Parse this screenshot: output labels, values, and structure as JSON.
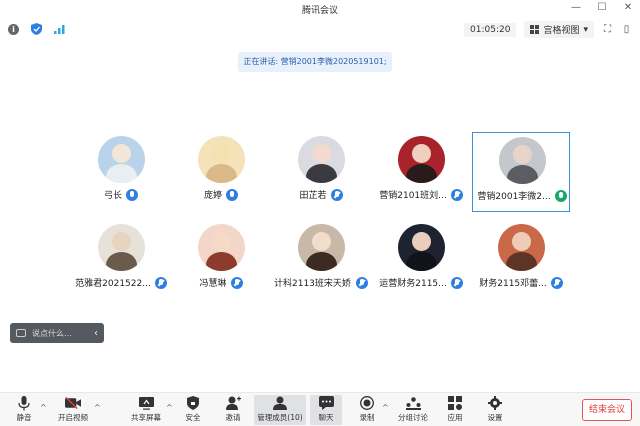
{
  "window": {
    "title": "腾讯会议"
  },
  "top": {
    "timer": "01:05:20",
    "view_label": "宫格视图"
  },
  "speaking": {
    "text": "正在讲话: 营销2001李微2020519101;"
  },
  "participants": [
    {
      "name": "弓长",
      "mic": "on",
      "colors": {
        "bg": "#b9d4ea",
        "head": "#f3e6d8",
        "body": "#e9eef3"
      }
    },
    {
      "name": "庞婷",
      "mic": "on",
      "colors": {
        "bg": "#f4e2b8",
        "head": "#f5e0b0",
        "body": "#d9b987"
      }
    },
    {
      "name": "田芷若",
      "mic": "muted",
      "colors": {
        "bg": "#d9dbe0",
        "head": "#f3d9cf",
        "body": "#3a3a40"
      }
    },
    {
      "name": "营销2101班刘...",
      "mic": "muted",
      "colors": {
        "bg": "#a8232c",
        "head": "#f0cfc0",
        "body": "#2a1b1b"
      }
    },
    {
      "name": "营销2001李微2...",
      "mic": "speaking",
      "active": true,
      "colors": {
        "bg": "#c4c7cc",
        "head": "#e7d4c9",
        "body": "#5b5d62"
      }
    },
    {
      "name": "范雅君2021522...",
      "mic": "muted",
      "colors": {
        "bg": "#e7e2d9",
        "head": "#ead3bd",
        "body": "#6a5b4d"
      }
    },
    {
      "name": "冯慧琳",
      "mic": "muted",
      "colors": {
        "bg": "#f2d7c9",
        "head": "#f7d9c7",
        "body": "#8d3b2d"
      }
    },
    {
      "name": "计科2113班宋天娇...",
      "mic": "muted",
      "colors": {
        "bg": "#c8b8a8",
        "head": "#f2dccb",
        "body": "#3b2b22"
      }
    },
    {
      "name": "运营财务2115...",
      "mic": "muted",
      "colors": {
        "bg": "#1f2230",
        "head": "#e9cdbd",
        "body": "#111319"
      }
    },
    {
      "name": "财务2115邓蕾...",
      "mic": "muted",
      "colors": {
        "bg": "#c9694a",
        "head": "#f0ccb8",
        "body": "#5d3426"
      }
    }
  ],
  "chat_popup": {
    "placeholder": "说点什么..."
  },
  "toolbar": {
    "mute": "静音",
    "video": "开启视频",
    "share": "共享屏幕",
    "security": "安全",
    "invite": "邀请",
    "members": "管理成员(10)",
    "chat": "聊天",
    "record": "录制",
    "breakout": "分组讨论",
    "apps": "应用",
    "settings": "设置",
    "end": "结束会议"
  }
}
